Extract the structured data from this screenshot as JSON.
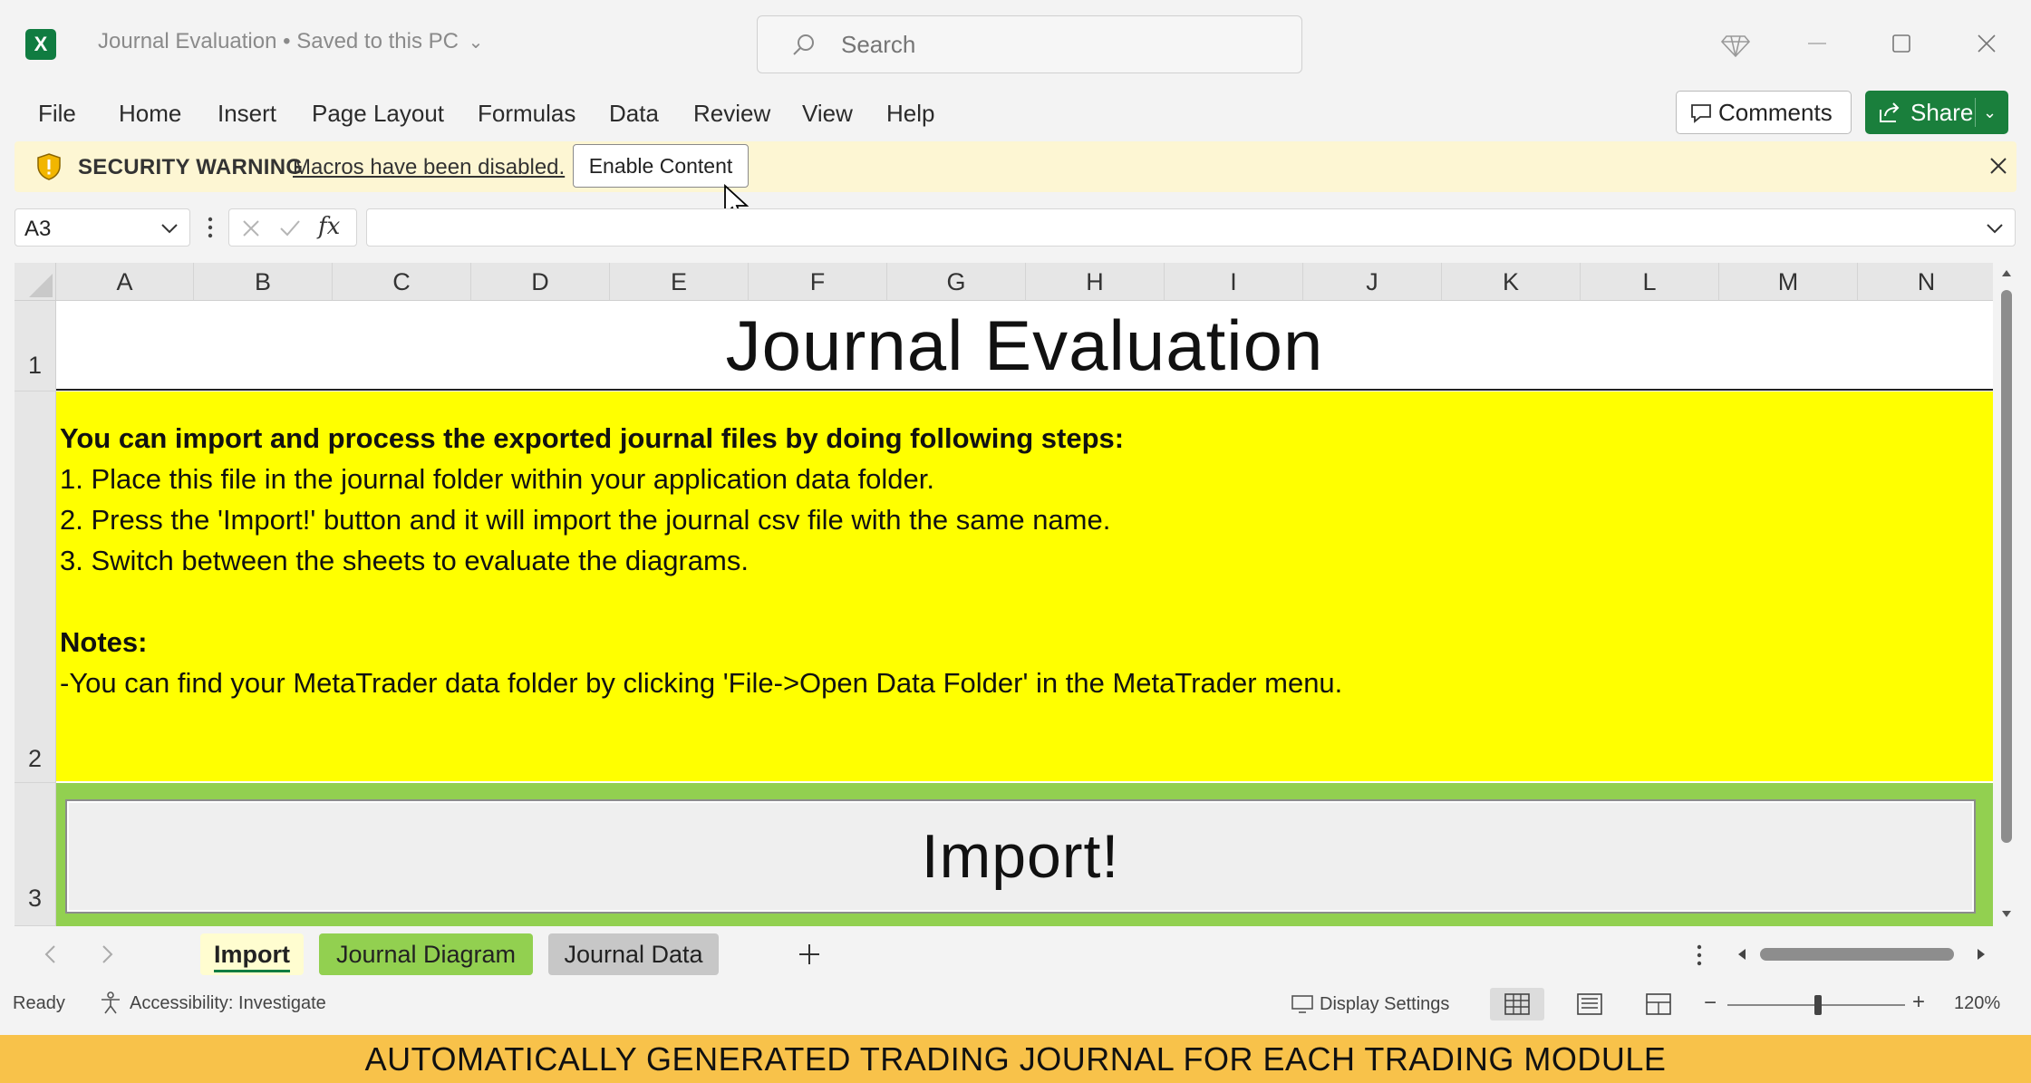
{
  "window": {
    "doc_title": "Journal Evaluation",
    "save_status": "• Saved to this PC",
    "search_placeholder": "Search"
  },
  "ribbon": {
    "tabs": [
      "File",
      "Home",
      "Insert",
      "Page Layout",
      "Formulas",
      "Data",
      "Review",
      "View",
      "Help"
    ],
    "comments_label": "Comments",
    "share_label": "Share"
  },
  "security_bar": {
    "title": "SECURITY WARNING",
    "message": "Macros have been disabled.",
    "button_label": "Enable Content"
  },
  "formula_bar": {
    "name_box": "A3",
    "fx_label": "fx",
    "formula": ""
  },
  "grid": {
    "columns": [
      "A",
      "B",
      "C",
      "D",
      "E",
      "F",
      "G",
      "H",
      "I",
      "J",
      "K",
      "L",
      "M",
      "N"
    ],
    "rows": [
      "1",
      "2",
      "3"
    ],
    "title": "Journal Evaluation",
    "instructions": [
      {
        "text": "You can import and process the exported journal files by doing following steps:",
        "bold": true
      },
      {
        "text": "1. Place this file in the journal folder within your application data folder.",
        "bold": false
      },
      {
        "text": "2. Press the 'Import!' button and it will import the journal csv file with the same name.",
        "bold": false
      },
      {
        "text": "3. Switch between the sheets to evaluate the diagrams.",
        "bold": false
      },
      {
        "text": "",
        "bold": false
      },
      {
        "text": "Notes:",
        "bold": true
      },
      {
        "text": "-You can find your MetaTrader data folder by clicking 'File->Open Data Folder' in the MetaTrader menu.",
        "bold": false
      }
    ],
    "import_button": "Import!",
    "colors": {
      "yellow": "#ffff00",
      "green": "#92d050"
    }
  },
  "sheets": {
    "tabs": [
      {
        "label": "Import",
        "active": true,
        "color": "#fffdd0"
      },
      {
        "label": "Journal Diagram",
        "active": false,
        "color": "#92d050"
      },
      {
        "label": "Journal Data",
        "active": false,
        "color": "#c7c7c7"
      }
    ]
  },
  "status": {
    "ready": "Ready",
    "accessibility": "Accessibility: Investigate",
    "display_settings": "Display Settings",
    "zoom": "120%"
  },
  "caption": "AUTOMATICALLY GENERATED TRADING JOURNAL FOR EACH TRADING MODULE",
  "icons": [
    "excel-logo-icon",
    "search-icon",
    "diamond-icon",
    "minimize-icon",
    "maximize-icon",
    "close-icon",
    "comment-icon",
    "share-icon",
    "shield-icon",
    "cursor-icon",
    "chevron-down-icon",
    "cancel-icon",
    "check-icon",
    "accessibility-icon",
    "display-settings-icon"
  ]
}
